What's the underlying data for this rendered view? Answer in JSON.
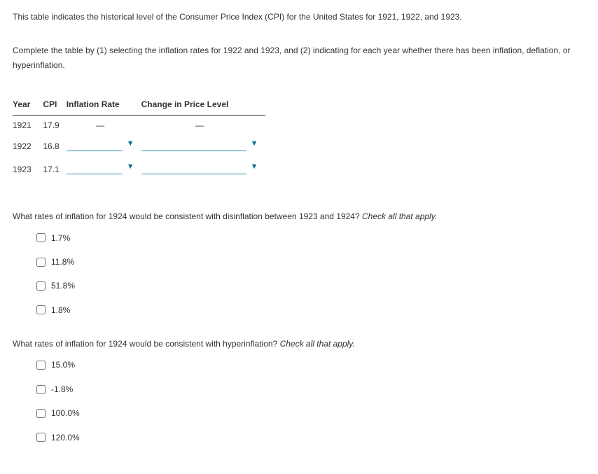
{
  "intro": "This table indicates the historical level of the Consumer Price Index (CPI) for the United States for 1921, 1922, and 1923.",
  "instructions": "Complete the table by (1) selecting the inflation rates for 1922 and 1923, and (2) indicating for each year whether there has been inflation, deflation, or hyperinflation.",
  "table": {
    "headers": {
      "year": "Year",
      "cpi": "CPI",
      "rate": "Inflation Rate",
      "change": "Change in Price Level"
    },
    "rows": [
      {
        "year": "1921",
        "cpi": "17.9",
        "rate": "—",
        "change": "—"
      },
      {
        "year": "1922",
        "cpi": "16.8"
      },
      {
        "year": "1923",
        "cpi": "17.1"
      }
    ]
  },
  "q1": {
    "text": "What rates of inflation for 1924 would be consistent with disinflation between 1923 and 1924? ",
    "hint": "Check all that apply.",
    "options": [
      "1.7%",
      "11.8%",
      "51.8%",
      "1.8%"
    ]
  },
  "q2": {
    "text": "What rates of inflation for 1924 would be consistent with hyperinflation? ",
    "hint": "Check all that apply.",
    "options": [
      "15.0%",
      "-1.8%",
      "100.0%",
      "120.0%"
    ]
  }
}
